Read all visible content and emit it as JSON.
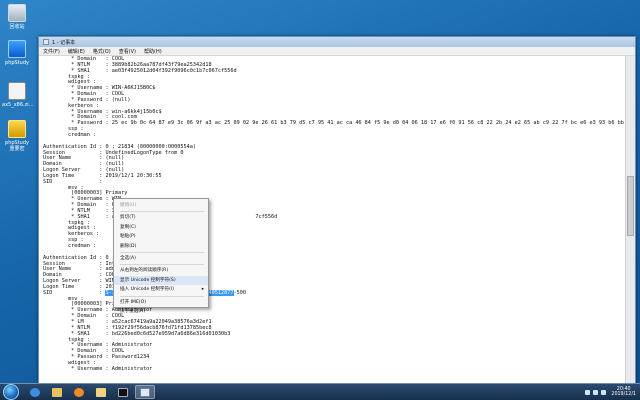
{
  "desktop": {
    "icons": [
      {
        "label": "回收站"
      },
      {
        "label": "phpStudy"
      },
      {
        "label": "ax5_x86.zi…"
      },
      {
        "label": "phpStudy 重要密"
      }
    ]
  },
  "window": {
    "title": "1 - 记事本",
    "menu": [
      "文件(F)",
      "编辑(E)",
      "格式(O)",
      "查看(V)",
      "帮助(H)"
    ]
  },
  "editor": {
    "lines": [
      "         * Domain   : COOL",
      "         * NTLM     : 3889b82b26aa787df43f79ea25342d18",
      "         * SHA1     : ae03f4925012d04f392f9096c0c1b7c067cf556d",
      "        tspkg :",
      "        wdigest :",
      "         * Username : WIN-A6KJ15B0C$",
      "         * Domain   : COOL",
      "         * Password : (null)",
      "        kerberos :",
      "         * Username : win-a6kk4j15b0c$",
      "         * Domain   : cool.com",
      "         * Password : 25 ec 9b 0c 64 87 e9 3c 06 9f a3 ac 25 09 02 9e 26 61 b3 79 d5 c7 95 41 ac ca 46 84 f5 9e d0 04 06 18 17 e6 f0 91 56 c8 22 2b 24 e2 65 ab c9 22 7f bc e6 e3 93 b6 bb bd 04",
      "        ssp :",
      "        credman :",
      "",
      "Authentication Id : 0 ; 21834 (00000000:0000554a)",
      "Session           : UndefinedLogonType from 0",
      "User Name         : (null)",
      "Domain            : (null)",
      "Logon Server      : (null)",
      "Logon Time        : 2019/12/1 20:30:55",
      "SID               :",
      "        msv :",
      "         [00000003] Primary",
      "         * Username : WIN-",
      "         * Domain   : COOL",
      "         * NTLM     : 3889",
      "         * SHA1     : ae0                                           7cf556d",
      "        tspkg :",
      "        wdigest :",
      "        kerberos :",
      "        ssp :",
      "        credman :",
      "",
      "Authentication Id : 0 ; 15",
      "Session           : Inter",
      "User Name         : admin",
      "Domain            : COOL",
      "Logon Server      : WIN-a",
      "Logon Time        : 2019/",
      "SID               : S-1-5-21-1563219827-2340712356-3040512877-500",
      "        msv :",
      "         [00000003] Primary",
      "         * Username : Administrator",
      "         * Domain   : COOL",
      "         * LM       : a52cac67419a9a22049a38576a3d2ef1",
      "         * NTLM     : f192f29f56dacb876fd71fd13785bec8",
      "         * SHA1     : bd226bed0c6d527e959d7a6d86e316d01030b3",
      "        tspkg :",
      "         * Username : Administrator",
      "         * Domain   : COOL",
      "         * Password : Password1234",
      "        wdigest :",
      "         * Username : Administrator"
    ]
  },
  "context_menu": {
    "items": [
      {
        "label": "撤销(U)",
        "disabled": true
      },
      {
        "sep": true
      },
      {
        "label": "剪切(T)"
      },
      {
        "label": "复制(C)"
      },
      {
        "label": "粘贴(P)"
      },
      {
        "label": "删除(D)"
      },
      {
        "sep": true
      },
      {
        "label": "全选(A)"
      },
      {
        "sep": true
      },
      {
        "label": "从右到左的阅读顺序(R)"
      },
      {
        "label": "显示 Unicode 控制字符(S)",
        "highlighted": true
      },
      {
        "label": "插入 Unicode 控制字符(I)",
        "submenu": true
      },
      {
        "sep": true
      },
      {
        "label": "打开 IME(O)"
      },
      {
        "label": "汉字重选(R)"
      }
    ]
  },
  "taskbar": {
    "clock_time": "20:40",
    "clock_date": "2019/12/1"
  },
  "colors": {
    "selection": "#3399ff",
    "desktop": "#1565a8",
    "taskbar": "#17304d"
  }
}
